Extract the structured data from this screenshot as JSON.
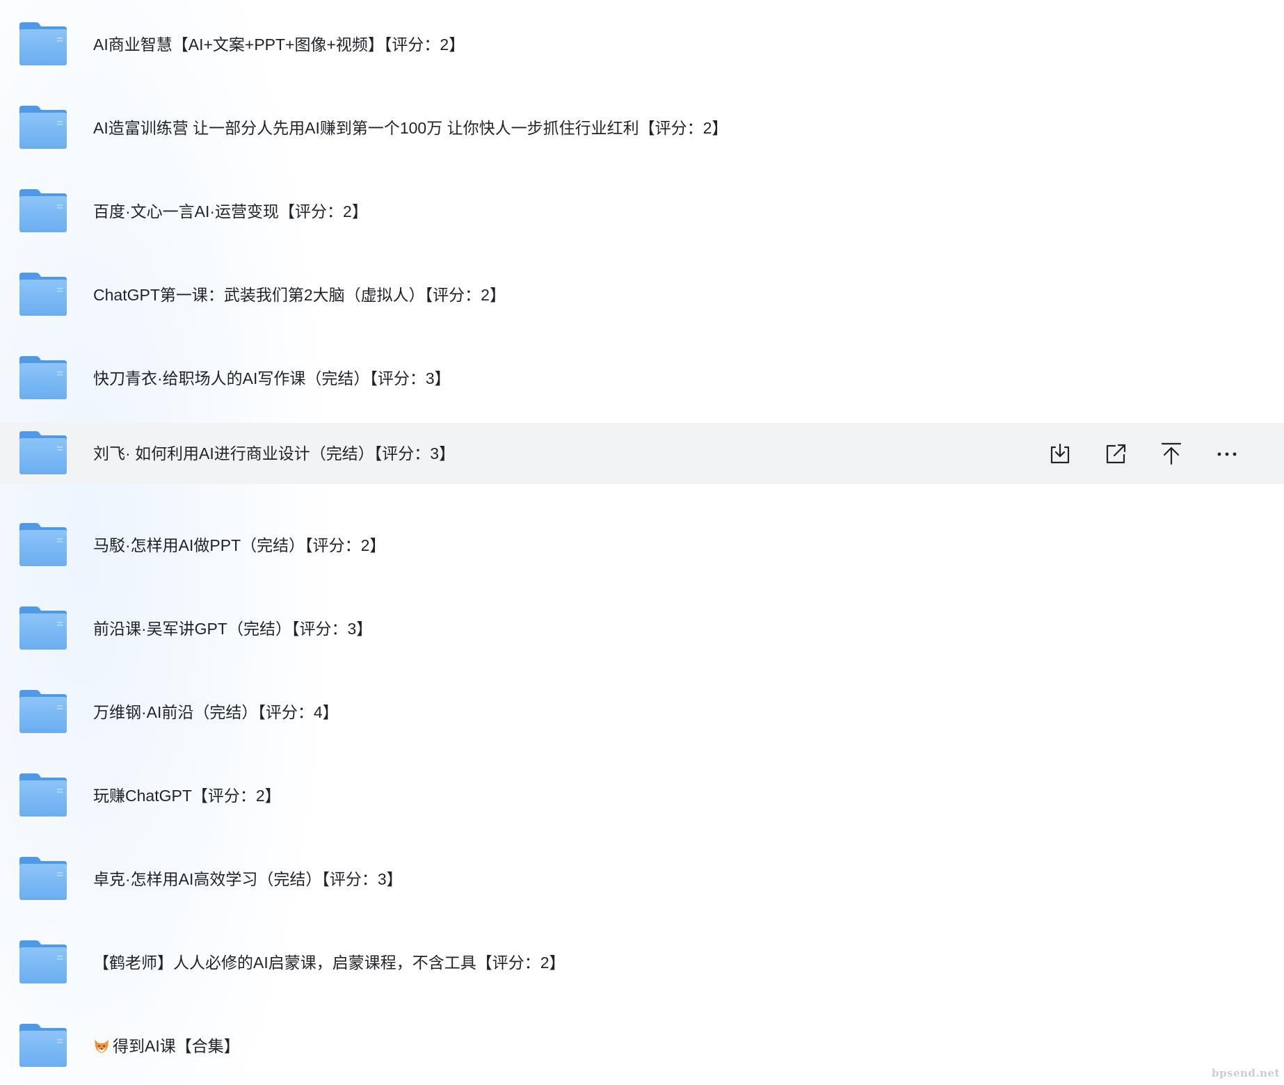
{
  "files": [
    {
      "name": "AI商业智慧【AI+文案+PPT+图像+视频】【评分：2】",
      "type": "folder"
    },
    {
      "name": "AI造富训练营 让一部分人先用AI赚到第一个100万 让你快人一步抓住行业红利【评分：2】",
      "type": "folder"
    },
    {
      "name": "百度·文心一言AI·运营变现【评分：2】",
      "type": "folder"
    },
    {
      "name": "ChatGPT第一课：武装我们第2大脑（虚拟人）【评分：2】",
      "type": "folder"
    },
    {
      "name": "快刀青衣·给职场人的AI写作课（完结）【评分：3】",
      "type": "folder"
    },
    {
      "name": "刘飞· 如何利用AI进行商业设计（完结）【评分：3】",
      "type": "folder",
      "hovered": true
    },
    {
      "name": "马駁·怎样用AI做PPT（完结）【评分：2】",
      "type": "folder"
    },
    {
      "name": "前沿课·吴军讲GPT（完结）【评分：3】",
      "type": "folder"
    },
    {
      "name": "万维钢·AI前沿（完结）【评分：4】",
      "type": "folder"
    },
    {
      "name": "玩赚ChatGPT【评分：2】",
      "type": "folder"
    },
    {
      "name": "卓克·怎样用AI高效学习（完结）【评分：3】",
      "type": "folder"
    },
    {
      "name": "【鹤老师】人人必修的AI启蒙课，启蒙课程，不含工具【评分：2】",
      "type": "folder"
    },
    {
      "name": "得到AI课【合集】",
      "type": "folder",
      "leading_icon": "fox-emoji-icon"
    }
  ],
  "row_actions": [
    {
      "icon": "download-icon"
    },
    {
      "icon": "share-icon"
    },
    {
      "icon": "pin-to-top-icon"
    },
    {
      "icon": "more-icon"
    }
  ],
  "watermark": "bpsend.net",
  "colors": {
    "folder_front": "#7ab8f5",
    "folder_back": "#4f9ae8",
    "hover_row": "#f2f3f5",
    "text": "#1f2329"
  }
}
